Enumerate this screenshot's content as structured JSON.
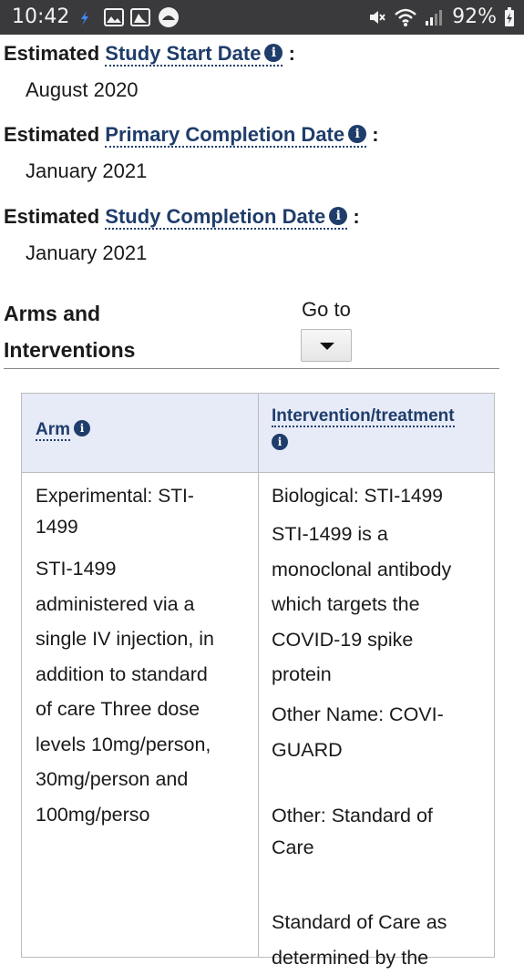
{
  "status_bar": {
    "time": "10:42",
    "battery": "92%"
  },
  "dates": [
    {
      "prefix": "Estimated",
      "term": "Study Start Date",
      "colon": ":",
      "value": "August 2020"
    },
    {
      "prefix": "Estimated",
      "term": "Primary Completion Date",
      "colon": ":",
      "value": "January 2021"
    },
    {
      "prefix": "Estimated",
      "term": "Study Completion Date",
      "colon": ":",
      "value": "January 2021"
    }
  ],
  "section": {
    "title_line1": "Arms and",
    "title_line2": "Interventions",
    "goto_label": "Go to"
  },
  "table": {
    "headers": {
      "arm": "Arm",
      "intervention": "Intervention/treatment"
    },
    "arm_cell": {
      "type_line1": "Experimental: STI-",
      "type_line2": "1499",
      "desc_lines": [
        "STI-1499",
        "administered via a",
        "single IV injection, in",
        "addition to standard",
        "of care Three dose",
        "levels 10mg/person,",
        "30mg/person and",
        "100mg/perso"
      ]
    },
    "intervention_cell": {
      "item1_title": "Biological: STI-1499",
      "item1_desc_lines": [
        "STI-1499 is a",
        "monoclonal antibody",
        "which targets the",
        "COVID-19 spike",
        "protein"
      ],
      "item1_other_line1": "Other Name: COVI-",
      "item1_other_line2": "GUARD",
      "item2_title_line1": "Other: Standard of",
      "item2_title_line2": "Care",
      "item2_desc_lines": [
        "Standard of Care as",
        "determined by the"
      ]
    }
  },
  "icons": {
    "info": "info-circle-icon",
    "dropdown": "triangle-down-icon"
  }
}
